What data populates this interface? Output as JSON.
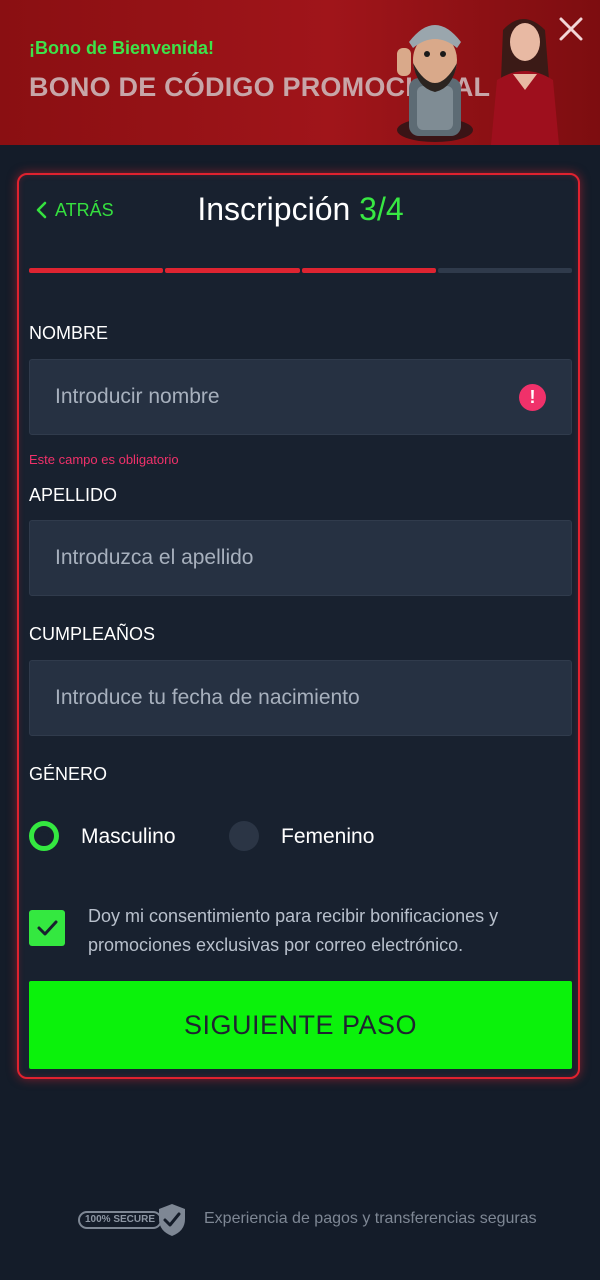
{
  "banner": {
    "subtitle": "¡Bono de Bienvenida!",
    "title": "BONO DE CÓDIGO PROMOCIONAL",
    "close_icon": "close-icon"
  },
  "form": {
    "back_label": "ATRÁS",
    "title": "Inscripción",
    "step": "3/4",
    "progress": {
      "completed": 3,
      "total": 4
    },
    "fields": {
      "first_name": {
        "label": "NOMBRE",
        "placeholder": "Introducir nombre",
        "error": "Este campo es obligatorio"
      },
      "last_name": {
        "label": "APELLIDO",
        "placeholder": "Introduzca el apellido"
      },
      "birthday": {
        "label": "CUMPLEAÑOS",
        "placeholder": "Introduce tu fecha de nacimiento"
      }
    },
    "gender": {
      "label": "GÉNERO",
      "options": [
        "Masculino",
        "Femenino"
      ],
      "selected": "Masculino"
    },
    "consent": {
      "checked": true,
      "text": "Doy mi consentimiento para recibir bonificaciones y promociones exclusivas por correo electrónico."
    },
    "submit_label": "SIGUIENTE PASO"
  },
  "footer": {
    "badge": "100% SECURE",
    "text": "Experiencia de pagos y transferencias seguras"
  },
  "colors": {
    "accent_green": "#0bf20b",
    "accent_red": "#dd2431",
    "error_pink": "#f0316a",
    "background": "#141c29"
  }
}
